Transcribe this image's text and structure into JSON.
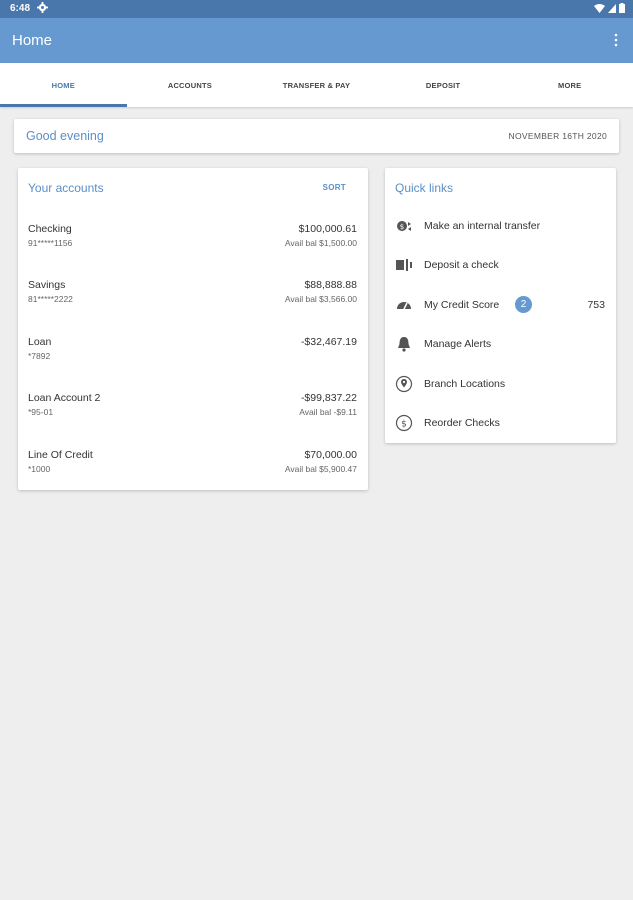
{
  "status": {
    "time": "6:48"
  },
  "appbar": {
    "title": "Home"
  },
  "tabs": [
    {
      "label": "HOME"
    },
    {
      "label": "ACCOUNTS"
    },
    {
      "label": "TRANSFER & PAY"
    },
    {
      "label": "DEPOSIT"
    },
    {
      "label": "MORE"
    }
  ],
  "greeting": {
    "text": "Good evening",
    "date": "NOVEMBER 16TH 2020"
  },
  "accounts": {
    "title": "Your accounts",
    "sort_label": "SORT",
    "items": [
      {
        "name": "Checking",
        "number": "91*****1156",
        "balance": "$100,000.61",
        "avail": "Avail bal $1,500.00"
      },
      {
        "name": "Savings",
        "number": "81*****2222",
        "balance": "$88,888.88",
        "avail": "Avail bal $3,566.00"
      },
      {
        "name": "Loan",
        "number": "*7892",
        "balance": "-$32,467.19",
        "avail": ""
      },
      {
        "name": "Loan Account 2",
        "number": "*95-01",
        "balance": "-$99,837.22",
        "avail": "Avail bal -$9.11"
      },
      {
        "name": "Line Of Credit",
        "number": "*1000",
        "balance": "$70,000.00",
        "avail": "Avail bal $5,900.47"
      }
    ]
  },
  "quick_links": {
    "title": "Quick links",
    "items": [
      {
        "label": "Make an internal transfer",
        "icon": "transfer-icon"
      },
      {
        "label": "Deposit a check",
        "icon": "check-deposit-icon"
      },
      {
        "label": "My Credit Score",
        "icon": "gauge-icon",
        "badge": "2",
        "value": "753"
      },
      {
        "label": "Manage Alerts",
        "icon": "bell-icon"
      },
      {
        "label": "Branch Locations",
        "icon": "location-pin-icon"
      },
      {
        "label": "Reorder Checks",
        "icon": "dollar-circle-icon"
      }
    ]
  },
  "colors": {
    "status_bar": "#4a77ab",
    "app_bar": "#6699d0",
    "accent": "#5b8fc7",
    "background": "#eeeeee"
  }
}
